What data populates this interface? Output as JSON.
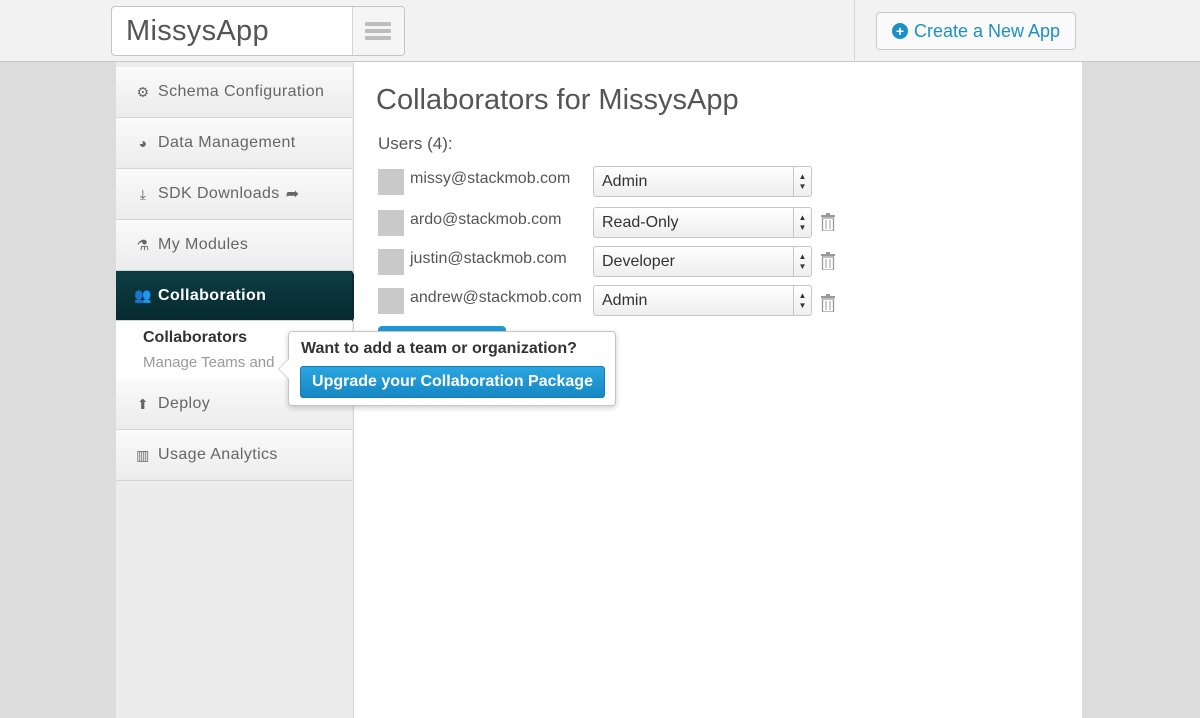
{
  "header": {
    "app_name": "MissysApp",
    "create_label": "Create a New App"
  },
  "sidebar": {
    "items": [
      {
        "label": "Schema Configuration",
        "icon": "gears-icon"
      },
      {
        "label": "Data Management",
        "icon": "dashboard-icon"
      },
      {
        "label": "SDK Downloads",
        "icon": "download-icon"
      },
      {
        "label": "My Modules",
        "icon": "flask-icon"
      },
      {
        "label": "Collaboration",
        "icon": "users-icon",
        "active": true
      },
      {
        "label": "Deploy",
        "icon": "arrow-circle-up-icon"
      },
      {
        "label": "Usage Analytics",
        "icon": "bar-chart-icon"
      }
    ],
    "sub": {
      "title": "Collaborators",
      "link": "Manage Teams and"
    }
  },
  "main": {
    "title": "Collaborators for MissysApp",
    "users_label": "Users (4):",
    "users": [
      {
        "email": "missy@stackmob.com",
        "role": "Admin",
        "deletable": false
      },
      {
        "email": "ardo@stackmob.com",
        "role": "Read-Only",
        "deletable": true
      },
      {
        "email": "justin@stackmob.com",
        "role": "Developer",
        "deletable": true
      },
      {
        "email": "andrew@stackmob.com",
        "role": "Admin",
        "deletable": true
      }
    ]
  },
  "popover": {
    "text": "Want to add a team or organization?",
    "button": "Upgrade your Collaboration Package"
  },
  "colors": {
    "accent": "#1b90c8",
    "active_nav": "#072b30",
    "button_blue": "#1d9ad6"
  }
}
